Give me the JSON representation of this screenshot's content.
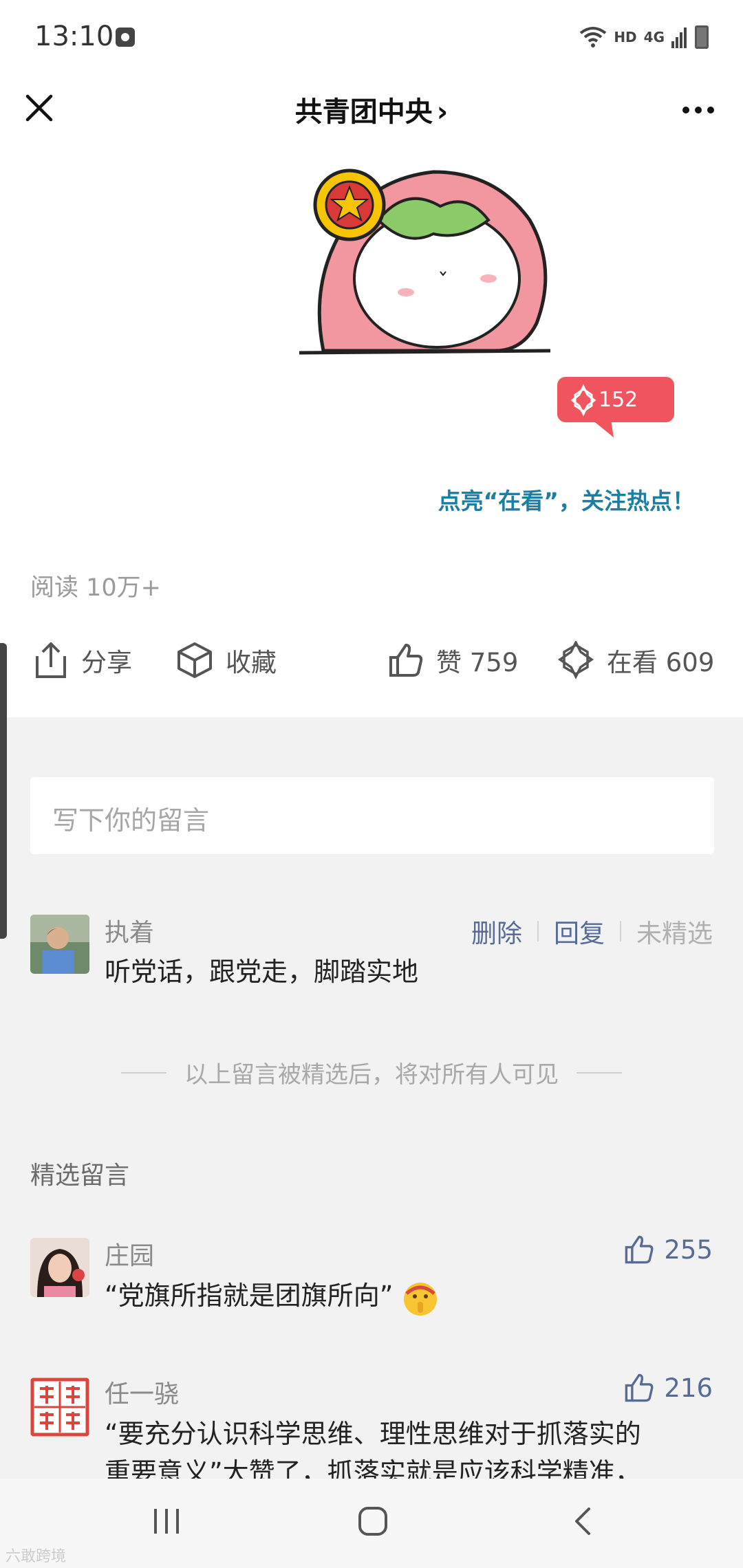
{
  "status": {
    "time": "13:10",
    "net": "HD",
    "sig": "4G"
  },
  "nav": {
    "title": "共青团中央",
    "title_arrow": "›"
  },
  "badge_count": "152",
  "cta": "点亮“在看”，关注热点！",
  "read_count": "阅读 10万+",
  "actions": {
    "share": "分享",
    "favorite": "收藏",
    "like": "赞 759",
    "watching": "在看 609"
  },
  "comment_input": {
    "placeholder": "写下你的留言"
  },
  "my_comment": {
    "name": "执着",
    "text": "听党话，跟党走，脚踏实地",
    "delete": "删除",
    "reply": "回复",
    "status": "未精选"
  },
  "notice": "以上留言被精选后，将对所有人可见",
  "featured_title": "精选留言",
  "featured": [
    {
      "name": "庄园",
      "text": "“党旗所指就是团旗所向”",
      "likes": "255"
    },
    {
      "name": "任一骁",
      "text_line1": "“要充分认识科学思维、理性思维对于抓落实的",
      "text_line2": "重要意义”大赞了，抓落实就是应该科学精准，",
      "likes": "216"
    }
  ],
  "watermark": "六敢跨境",
  "colors": {
    "link": "#576b95",
    "cta": "#1a7ea5",
    "badge": "#f0555f",
    "comment_bg": "#f2f2f2"
  }
}
